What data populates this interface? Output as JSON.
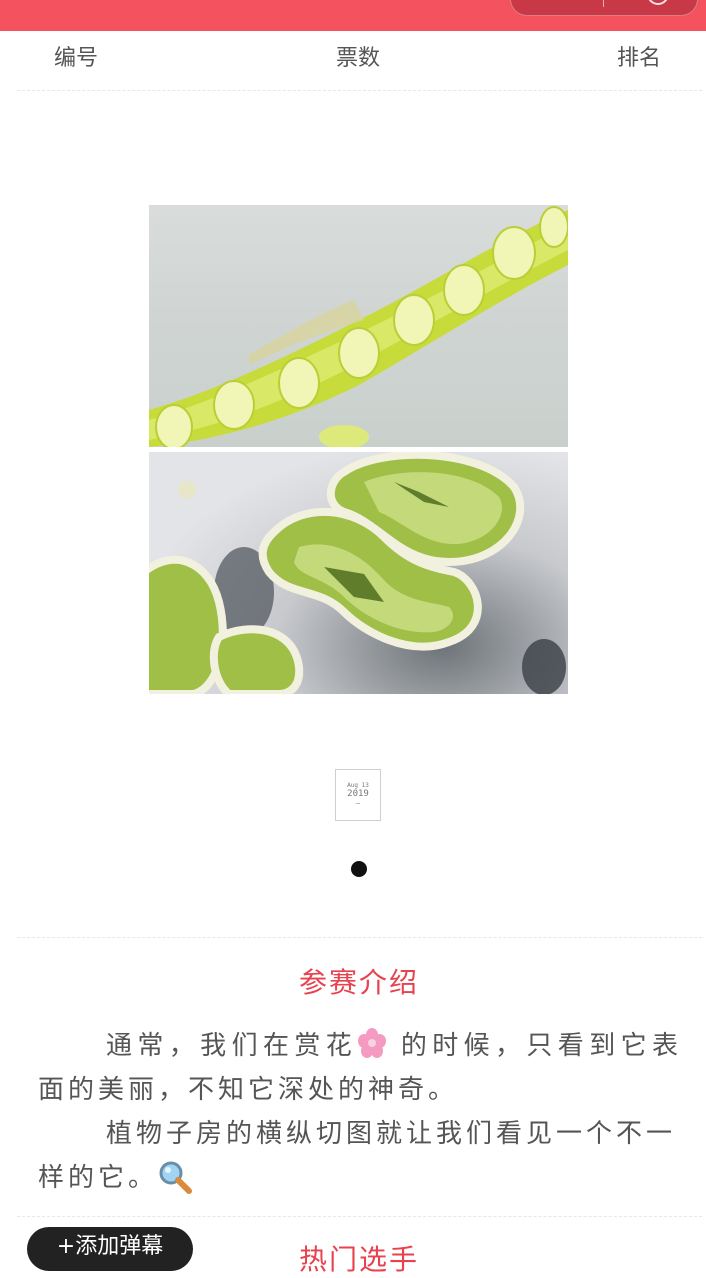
{
  "stats": {
    "number_label": "编号",
    "votes_label": "票数",
    "rank_label": "排名"
  },
  "photo_card": {
    "thumb_line1": "Aug 13",
    "thumb_line2": "2019",
    "thumb_line3": "—"
  },
  "intro": {
    "title": "参赛介绍",
    "para1_before": "通常，我们在赏花",
    "para1_after": " 的时候，只看到它表面的美丽，不知它深处的神奇。",
    "para2": "植物子房的横纵切图就让我们看见一个不一样的它。",
    "flower_icon": "cherry-blossom-icon",
    "magnifier_icon": "magnifier-icon"
  },
  "danmu": {
    "add_label": "+添加弹幕"
  },
  "hot": {
    "title": "热门选手"
  }
}
